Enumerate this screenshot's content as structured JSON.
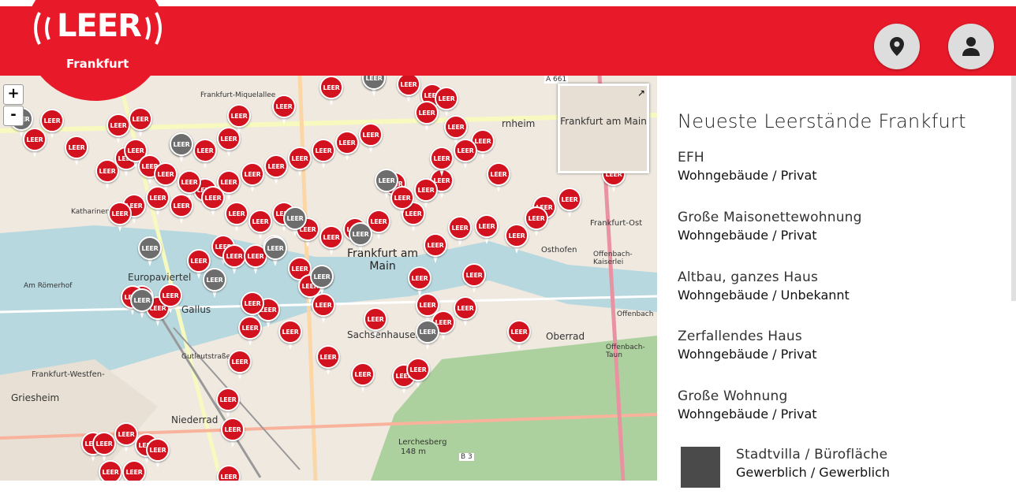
{
  "header": {
    "logo_text": "LEER",
    "city": "Frankfurt",
    "location_button": "map-marker-icon",
    "user_button": "user-icon",
    "colors": {
      "brand": "#e81a2a",
      "button_bg": "#dddddd"
    }
  },
  "map": {
    "zoom_in": "+",
    "zoom_out": "-",
    "minimap_label": "Frankfurt am Main",
    "minimap_toggle": "↗",
    "labels": {
      "griesheim": "Griesheim",
      "niederrad": "Niederrad",
      "gallus": "Gallus",
      "europaviertel": "Europaviertel",
      "oberrad": "Oberrad",
      "sachsenhausen": "Sachsenhausen",
      "frankfurt_main": "Frankfurt am\nMain",
      "ostend": "Osthofen",
      "frankfurt_ost": "Frankfurt-Ost",
      "lerchesberg": "Lerchesberg",
      "lerchesberg_height": "148 m",
      "frankfurt_west": "Frankfurt-Westfen-",
      "a661": "A 661",
      "b3": "B 3",
      "am_romerhof": "Am Römerhof",
      "katharinen": "Katharinenk",
      "mainz_frankfurt": "Frankfurt",
      "bornheim": "rnheim",
      "frankfurt_miquelallee": "Frankfurt-Miquelallee",
      "offenbach_kaiserlei": "Offenbach-Kaiserlei",
      "offenbach_taunus": "Offenbach-Taun",
      "offenbach": "Offenbach",
      "gutleutstrasse": "Gutleutstraße",
      "mainzer": "Main"
    },
    "pin_label": "LEER",
    "pin_colors": {
      "active": "#d2121f",
      "inactive": "#6d6d6d"
    }
  },
  "panel": {
    "title": "Neueste Leerstände Frankfurt",
    "items": [
      {
        "title": "EFH",
        "category": "Wohngebäude / Privat"
      },
      {
        "title": "Große Maisonettewohnung",
        "category": "Wohngebäude / Privat"
      },
      {
        "title": "Altbau, ganzes Haus",
        "category": "Wohngebäude / Unbekannt"
      },
      {
        "title": "Zerfallendes Haus",
        "category": "Wohngebäude / Privat"
      },
      {
        "title": "Große Wohnung",
        "category": "Wohngebäude / Privat"
      },
      {
        "title": "Stadtvilla / Bürofläche",
        "category": "Gewerblich / Gewerblich"
      }
    ]
  }
}
